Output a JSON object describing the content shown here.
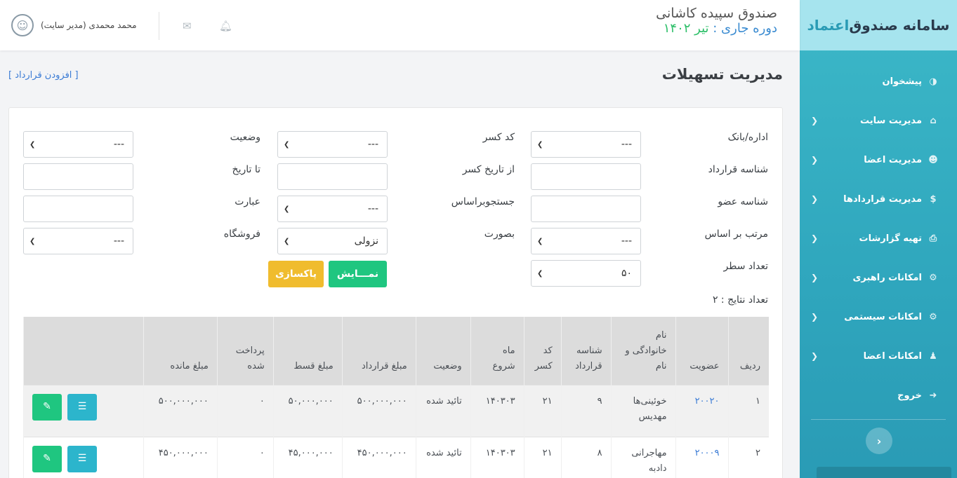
{
  "brand": {
    "title_main": "سامانه صندوق",
    "title_accent": "اعتماد"
  },
  "header": {
    "fund_name": "صندوق سپیده کاشانی",
    "period_label": "دوره جاری :",
    "period_value": "تیر ۱۴۰۲",
    "user_name": "محمد محمدی (مدیر سایت)"
  },
  "sidebar": {
    "items": [
      {
        "label": "پیشخوان",
        "icon": "dashboard-icon",
        "has_submenu": false
      },
      {
        "label": "مدیریت سایت",
        "icon": "home-icon",
        "has_submenu": true
      },
      {
        "label": "مدیریت اعضا",
        "icon": "users-icon",
        "has_submenu": true
      },
      {
        "label": "مدیریت قراردادها",
        "icon": "dollar-icon",
        "has_submenu": true
      },
      {
        "label": "تهیه گزارشات",
        "icon": "print-icon",
        "has_submenu": true
      },
      {
        "label": "امکانات راهبری",
        "icon": "gear-icon",
        "has_submenu": true
      },
      {
        "label": "امکانات سیستمی",
        "icon": "gear-icon",
        "has_submenu": true
      },
      {
        "label": "امکانات اعضا",
        "icon": "user-icon",
        "has_submenu": true
      },
      {
        "label": "خروج",
        "icon": "logout-icon",
        "has_submenu": false
      }
    ]
  },
  "page": {
    "title": "مدیریت تسهیلات",
    "add_link": "[ افزودن قرارداد ]"
  },
  "filters": {
    "office_bank": {
      "label": "اداره/بانک",
      "value": "---"
    },
    "deduction_code": {
      "label": "کد کسر",
      "value": "---"
    },
    "status": {
      "label": "وضعیت",
      "value": "---"
    },
    "contract_id": {
      "label": "شناسه قرارداد",
      "value": ""
    },
    "from_date": {
      "label": "از تاریخ کسر",
      "value": ""
    },
    "to_date": {
      "label": "تا تاریخ",
      "value": ""
    },
    "member_id": {
      "label": "شناسه عضو",
      "value": ""
    },
    "search_by": {
      "label": "جستجوبراساس",
      "value": "---"
    },
    "phrase": {
      "label": "عبارت",
      "value": ""
    },
    "sort_by": {
      "label": "مرتب بر اساس",
      "value": "---"
    },
    "order": {
      "label": "بصورت",
      "value": "نزولی"
    },
    "store": {
      "label": "فروشگاه",
      "value": "---"
    },
    "rows": {
      "label": "تعداد سطر",
      "value": "۵۰"
    }
  },
  "buttons": {
    "show": "نمـــایش",
    "clear": "پاکسازی"
  },
  "result_count": "تعداد نتایج : ۲",
  "table": {
    "headers": [
      "ردیف",
      "عضویت",
      "نام خانوادگی و نام",
      "شناسه قرارداد",
      "کد کسر",
      "ماه شروع",
      "وضعیت",
      "مبلغ قرارداد",
      "مبلغ قسط",
      "پرداخت شده",
      "مبلغ مانده",
      ""
    ],
    "rows": [
      {
        "index": "۱",
        "member": "۲۰۰۲۰",
        "name": "خوئینی‌ها مهدیس",
        "contract": "۹",
        "code": "۲۱",
        "start": "۱۴۰۳۰۳",
        "status": "تائید شده",
        "amount": "۵۰۰,۰۰۰,۰۰۰",
        "installment": "۵۰,۰۰۰,۰۰۰",
        "paid": "۰",
        "remaining": "۵۰۰,۰۰۰,۰۰۰"
      },
      {
        "index": "۲",
        "member": "۲۰۰۰۹",
        "name": "مهاجرانی دادبه",
        "contract": "۸",
        "code": "۲۱",
        "start": "۱۴۰۳۰۳",
        "status": "تائید شده",
        "amount": "۴۵۰,۰۰۰,۰۰۰",
        "installment": "۴۵,۰۰۰,۰۰۰",
        "paid": "۰",
        "remaining": "۴۵۰,۰۰۰,۰۰۰"
      }
    ]
  }
}
